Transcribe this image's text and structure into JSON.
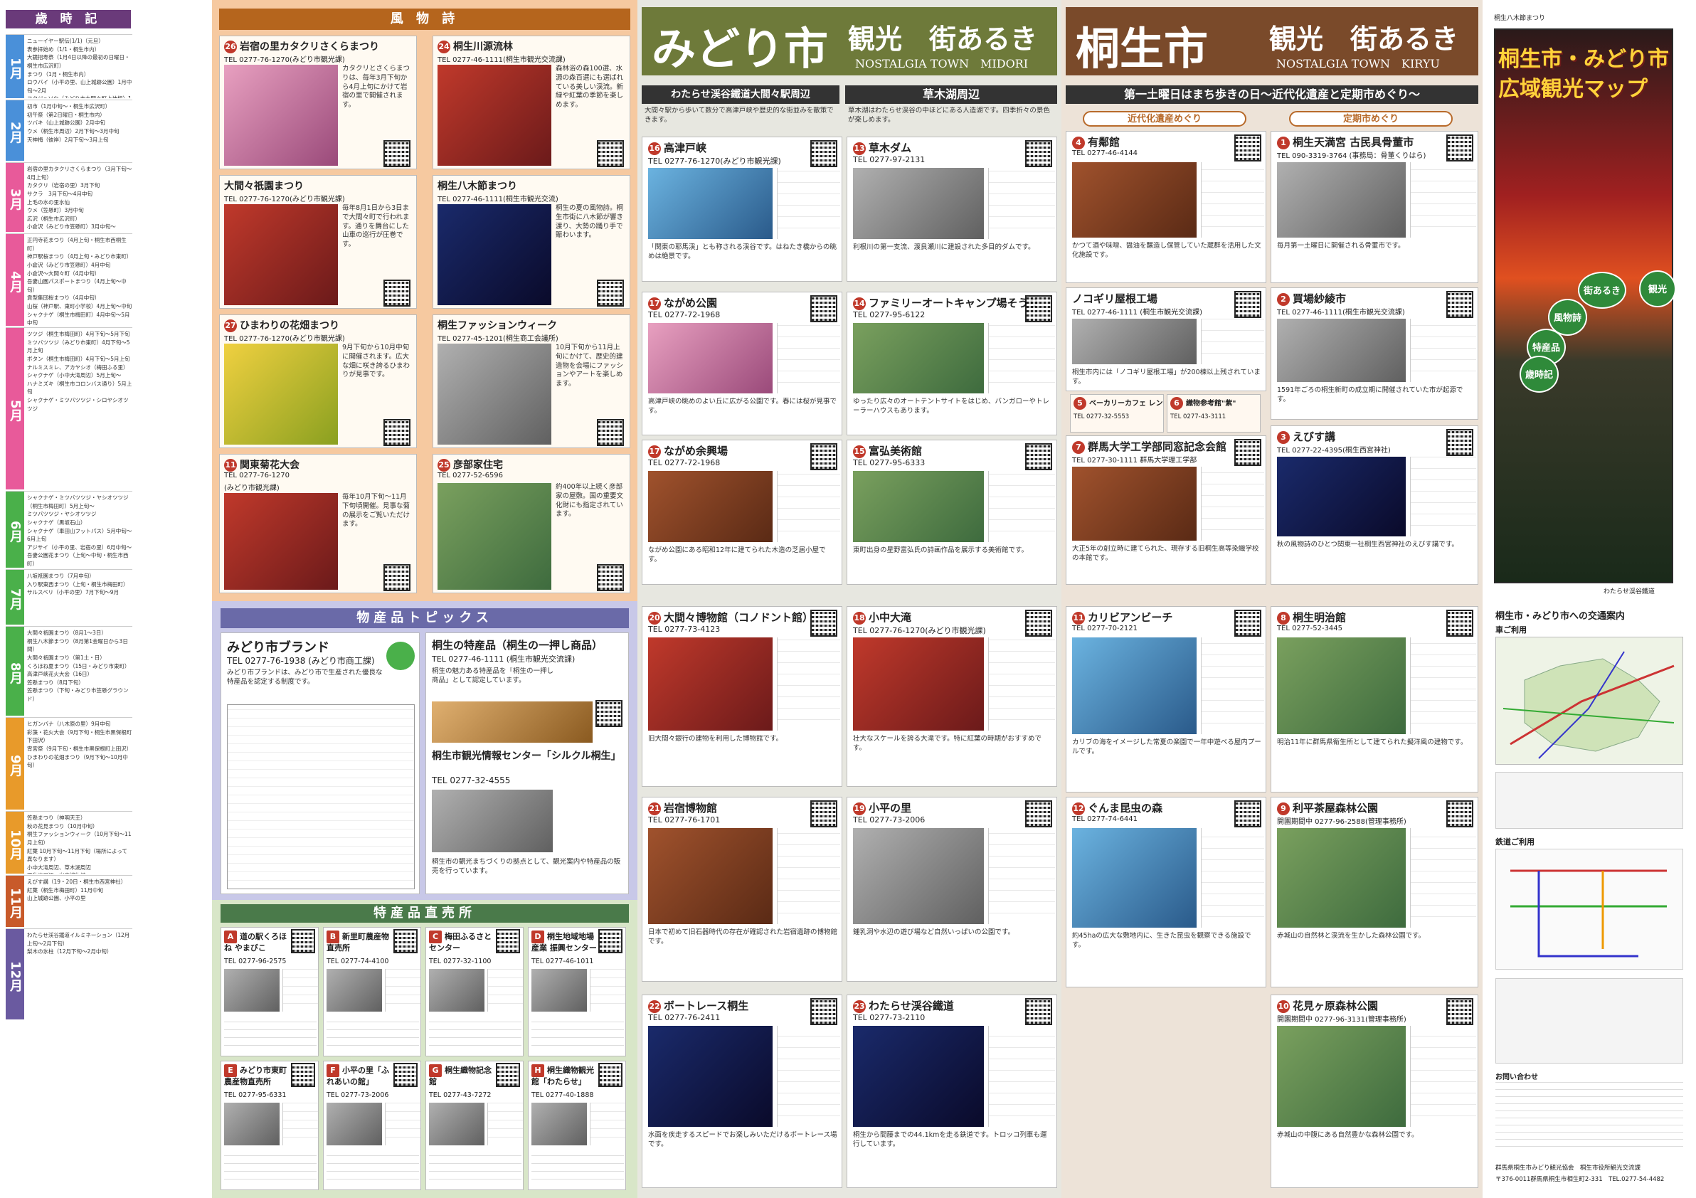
{
  "calendar": {
    "title": "歳 時 記",
    "months": [
      {
        "label": "1月",
        "color": "#4a90d9",
        "text": "ニューイヤー駅伝(1/1)（元旦）\n表参拝始め（1/1・桐生市内）\n大鏡招寿祭（1月4日以降の最初の日曜日・桐生市広沢町）\nまつり（1月・桐生市内）\nロウバイ（小平の里、山上城跡公園）1月中旬～2月\nフクジュソウ（みどり市大間々町上神梅）1月下旬～3月上旬"
      },
      {
        "label": "2月",
        "color": "#4a90d9",
        "text": "初市（1月中旬～・桐生市広沢町）\n初午祭（第2日曜日・桐生市内）\nツバキ（山上城跡公園）2月中旬\nウメ（桐生市周辺）2月下旬～3月中旬\n天神梅（彼岸）2月下旬～3月上旬"
      },
      {
        "label": "3月",
        "color": "#e85a9a",
        "text": "岩宿の里カタクリさくらまつり（3月下旬～4月上旬）\nカタクリ（岩宿の里）3月下旬\nサクラ　3月下旬～4月中旬\n上毛の水の里水仙\nウメ（笠懸町）3月中旬\n広沢（桐生市広沢町）\n小倉沢（みどり市笠懸町）3月中旬～\n小島沢～大間々町"
      },
      {
        "label": "4月",
        "color": "#e85a9a",
        "text": "正円寺花まつり（4月上旬・桐生市西桐生町）\n神戸駅桜まつり（4月上旬・みどり市東町）\n小倉沢（みどり市笠懸町）4月中旬\n小倉沢～大間々町（4月中旬）\n吾妻山園パスポートまつり（4月上旬～中旬）\n貢型集団桜まつり（4月中旬）\n山桜（神戸駅、東町小学校）4月上旬～中旬\nシャクナゲ（桐生市梅田町）4月中旬～5月中旬\nシャクナゲ・ヤシオツツジ（小中大滝周辺）\n桐生の花（車田山フットパス）4月下旬～5月上旬"
      },
      {
        "label": "5月",
        "color": "#e85a9a",
        "text": "ツツジ（桐生市梅田町）4月下旬～5月下旬\nミツバツツジ（みどり市東町）4月下旬～5月上旬\nボタン（桐生市梅田町）4月下旬～5月上旬\nナルミスミレ、アカヤシオ（梅田ふる里）\nシャクナゲ（小中大滝周辺）5月上旬～\nハナミズキ（桐生市コロンバス通り）5月上旬\nシャクナゲ・ミツバツツジ・シロヤシオツツジ"
      },
      {
        "label": "6月",
        "color": "#4ab04a",
        "text": "シャクナゲ・ミツバツツジ・ヤシオツツジ（桐生市梅田町）5月上旬～\nミツバツツジ・ヤシオツツジ\nシャクナゲ（黒坂石山）\nシャクナゲ（車田山フットパス）5月中旬～6月上旬\nアジサイ（小平の里、岩宿の里）6月中旬～\n吾妻公園花まつり（上旬～中旬・桐生市西町）"
      },
      {
        "label": "7月",
        "color": "#4ab04a",
        "text": "八坂祇園まつり（7月中旬）\n入り駅東西まつり（上旬・桐生市梅田町）\nサルスベリ（小平の里）7月下旬～9月"
      },
      {
        "label": "8月",
        "color": "#4ab04a",
        "text": "大間々祇園まつり（8月1～3日）\n桐生八木節まつり（8月第1金曜日から3日間）\n大間々祇園まつり（第1土・日）\nくろほね夏まつり（15日・みどり市東町）\n高津戸峡花火大会（16日）\n笠懸まつり（8月下旬）\n笠懸まつり（下旬・みどり市笠懸グラウンド）"
      },
      {
        "label": "9月",
        "color": "#e89a2a",
        "text": "ヒガンバナ（八木原の里）9月中旬\n彩藻・花火大会（9月下旬・桐生市黒保根町下田沢）\n宵宮祭（9月下旬・桐生市黒保根町上田沢）\nひまわりの花畑まつり（9月下旬～10月中旬）"
      },
      {
        "label": "10月",
        "color": "#e89a2a",
        "text": "笠懸まつり（神明天王）\n秋の花見まつり（10月中旬）\n桐生ファッションウィーク（10月下旬～11月上旬）\n紅葉 10月下旬～11月下旬（場所によって異なります）\n小中大滝周辺、草木湖周辺\n不動滝周辺、岩宿博物館"
      },
      {
        "label": "11月",
        "color": "#c85a2a",
        "text": "えびす講（19・20日・桐生市西宮神社）\n紅葉（桐生市梅田町）11月中旬\n山上城跡公園、小平の里"
      },
      {
        "label": "12月",
        "color": "#6a5aa0",
        "text": "わたらせ渓谷鐵道イルミネーション（12月上旬～2月下旬）\n梨木の氷柱（12月下旬～2月中旬）"
      }
    ]
  },
  "fuubutsu": {
    "head": "風 物 詩",
    "items": [
      {
        "no": "26",
        "title": "岩宿の里カタクリさくらまつり",
        "tel": "TEL 0277-76-1270(みどり市観光課)",
        "desc": "カタクリとさくらまつりは、毎年3月下旬から4月上旬にかけて岩宿の里で開催されます。"
      },
      {
        "no": "24",
        "title": "桐生川源流林",
        "tel": "TEL 0277-46-1111(桐生市観光交流課)",
        "desc": "森林浴の森100選、水源の森百選にも選ばれている美しい渓流。新緑や紅葉の季節を楽しめます。"
      },
      {
        "no": "",
        "title": "大間々祇園まつり",
        "tel": "TEL 0277-76-1270(みどり市観光課)",
        "desc": "毎年8月1日から3日まで大間々町で行われます。通りを舞台にした山車の巡行が圧巻です。"
      },
      {
        "no": "",
        "title": "桐生八木節まつり",
        "tel": "TEL 0277-46-1111(桐生市観光交流)",
        "desc": "桐生の夏の風物詩。桐生市街に八木節が響き渡り、大勢の踊り手で賑わいます。"
      },
      {
        "no": "27",
        "title": "ひまわりの花畑まつり",
        "tel": "TEL 0277-76-1270(みどり市観光課)",
        "desc": "9月下旬から10月中旬に開催されます。広大な畑に咲き誇るひまわりが見事です。"
      },
      {
        "no": "",
        "title": "桐生ファッションウィーク",
        "tel": "TEL 0277-45-1201(桐生商工会議所)",
        "desc": "10月下旬から11月上旬にかけて、歴史的建造物を会場にファッションやアートを楽しめます。"
      },
      {
        "no": "11",
        "title": "関東菊花大会",
        "tel": "TEL 0277-76-1270",
        "tel2": "(みどり市観光課)",
        "desc": "毎年10月下旬～11月下旬頃開催。見事な菊の展示をご覧いただけます。"
      },
      {
        "no": "25",
        "title": "彦部家住宅",
        "tel": "TEL 0277-52-6596",
        "desc": "約400年以上続く彦部家の屋敷。国の重要文化財にも指定されています。"
      }
    ]
  },
  "bussan": {
    "head": "物産品トピックス",
    "brand_title": "みどり市ブランド",
    "brand_tel": "TEL 0277-76-1938 (みどり市商工課)",
    "brand_desc": "みどり市ブランドは、みどり市で生産された優良な特産品を認定する制度です。",
    "kiryu_title": "桐生の特産品（桐生の一押し商品）",
    "kiryu_tel": "TEL 0277-46-1111 (桐生市観光交流課)",
    "kiryu_desc": "桐生の魅力ある特産品を「桐生の一押し商品」として認定しています。",
    "center_title": "桐生市観光情報センター「シルクル桐生」",
    "center_tel": "TEL 0277-32-4555",
    "center_desc": "桐生市の観光まちづくりの拠点として、観光案内や特産品の販売を行っています。"
  },
  "chokubai": {
    "head": "特産品直売所",
    "items": [
      {
        "no": "A",
        "title": "道の駅くろほね やまびこ",
        "tel": "TEL 0277-96-2575"
      },
      {
        "no": "B",
        "title": "新里町農産物 直売所",
        "tel": "TEL 0277-74-4100"
      },
      {
        "no": "C",
        "title": "梅田ふるさと センター",
        "tel": "TEL 0277-32-1100"
      },
      {
        "no": "D",
        "title": "桐生地域地場産業 振興センター",
        "tel": "TEL 0277-46-1011"
      },
      {
        "no": "E",
        "title": "みどり市東町 農産物直売所",
        "tel": "TEL 0277-95-6331"
      },
      {
        "no": "F",
        "title": "小平の里「ふれあいの館」",
        "tel": "TEL 0277-73-2006"
      },
      {
        "no": "G",
        "title": "桐生織物記念館",
        "tel": "TEL 0277-43-7272"
      },
      {
        "no": "H",
        "title": "桐生織物観光館「わたらせ」",
        "tel": "TEL 0277-40-1888"
      }
    ]
  },
  "midori": {
    "name": "みどり市",
    "catch": "観光　街あるき",
    "sub": "NOSTALGIA TOWN　MIDORI",
    "sec1": "わたらせ渓谷鐵道大間々駅周辺",
    "sec1_desc": "大間々駅から歩いて数分で高津戸峡や歴史的な街並みを散策できます。",
    "sec2": "草木湖周辺",
    "sec2_desc": "草木湖はわたらせ渓谷の中ほどにある人造湖です。四季折々の景色が楽しめます。",
    "spots": [
      {
        "no": "16",
        "title": "高津戸峡",
        "tel": "TEL 0277-76-1270(みどり市観光課)",
        "desc": "「関東の耶馬渓」とも称される渓谷です。はねたき橋からの眺めは絶景です。"
      },
      {
        "no": "13",
        "title": "草木ダム",
        "tel": "TEL 0277-97-2131",
        "desc": "利根川の第一支流、渡良瀬川に建設された多目的ダムです。"
      },
      {
        "no": "17",
        "title": "ながめ公園",
        "tel": "TEL 0277-72-1968",
        "desc": "高津戸峡の眺めのよい丘に広がる公園です。春には桜が見事です。"
      },
      {
        "no": "14",
        "title": "ファミリーオートキャンプ場そうり",
        "tel": "TEL 0277-95-6122",
        "desc": "ゆったり広々のオートテントサイトをはじめ、バンガローやトレーラーハウスもあります。"
      },
      {
        "no": "17",
        "title": "ながめ余興場",
        "tel": "TEL 0277-72-1968",
        "desc": "ながめ公園にある昭和12年に建てられた木造の芝居小屋です。"
      },
      {
        "no": "15",
        "title": "富弘美術館",
        "tel": "TEL 0277-95-6333",
        "desc": "東町出身の星野富弘氏の詩画作品を展示する美術館です。"
      },
      {
        "no": "20",
        "title": "大間々博物館（コノドント館）",
        "tel": "TEL 0277-73-4123",
        "desc": "旧大間々銀行の建物を利用した博物館です。"
      },
      {
        "no": "18",
        "title": "小中大滝",
        "tel": "TEL 0277-76-1270(みどり市観光課)",
        "desc": "壮大なスケールを誇る大滝です。特に紅葉の時期がおすすめです。"
      },
      {
        "no": "21",
        "title": "岩宿博物館",
        "tel": "TEL 0277-76-1701",
        "desc": "日本で初めて旧石器時代の存在が確認された岩宿遺跡の博物館です。"
      },
      {
        "no": "19",
        "title": "小平の里",
        "tel": "TEL 0277-73-2006",
        "desc": "鍾乳洞や水辺の遊び場など自然いっぱいの公園です。"
      },
      {
        "no": "22",
        "title": "ボートレース桐生",
        "tel": "TEL 0277-76-2411",
        "desc": "水面を疾走するスピードでお楽しみいただけるボートレース場です。"
      },
      {
        "no": "23",
        "title": "わたらせ渓谷鐵道",
        "tel": "TEL 0277-73-2110",
        "desc": "桐生から間藤までの44.1kmを走る鉄道です。トロッコ列車も運行しています。"
      }
    ]
  },
  "kiryu": {
    "name": "桐生市",
    "catch": "観光　街あるき",
    "sub": "NOSTALGIA TOWN　KIRYU",
    "band": "第一土曜日はまち歩きの日～近代化遺産と定期市めぐり～",
    "sub1": "近代化遺産めぐり",
    "sub2": "定期市めぐり",
    "spots": [
      {
        "no": "4",
        "title": "有鄰館",
        "tel": "TEL 0277-46-4144",
        "desc": "かつて酒や味噌、醤油を醸造し保管していた蔵群を活用した文化施設です。"
      },
      {
        "no": "1",
        "title": "桐生天満宮 古民具骨董市",
        "tel": "TEL 090-3319-3764 (事務局：骨董くりはら)",
        "desc": "毎月第一土曜日に開催される骨董市です。"
      },
      {
        "no": "",
        "title": "ノコギリ屋根工場",
        "tel": "TEL 0277-46-1111 (桐生市観光交流課)",
        "desc": "桐生市内には「ノコギリ屋根工場」が200棟以上残されています。"
      },
      {
        "no": "2",
        "title": "買場紗綾市",
        "tel": "TEL 0277-46-1111(桐生市観光交流課)",
        "desc": "1591年ごろの桐生新町の成立期に開催されていた市が起源です。"
      },
      {
        "no": "5",
        "title": "ベーカリーカフェ レンガ",
        "tel": "TEL 0277-32-5553"
      },
      {
        "no": "6",
        "title": "織物参考館\"紫\"",
        "tel": "TEL 0277-43-3111"
      },
      {
        "no": "3",
        "title": "えびす講",
        "tel": "TEL 0277-22-4395(桐生西宮神社)",
        "desc": "秋の風物詩のひとつ関東一社桐生西宮神社のえびす講です。"
      },
      {
        "no": "7",
        "title": "群馬大学工学部同窓記念会館",
        "tel": "TEL 0277-30-1111 群馬大学理工学部",
        "desc": "大正5年の創立時に建てられた、現存する旧桐生高等染織学校の本館です。"
      },
      {
        "no": "11",
        "title": "カリビアンビーチ",
        "tel": "TEL 0277-70-2121",
        "desc": "カリブの海をイメージした常夏の楽園で一年中遊べる屋内プールです。"
      },
      {
        "no": "8",
        "title": "桐生明治館",
        "tel": "TEL 0277-52-3445",
        "desc": "明治11年に群馬県衛生所として建てられた擬洋風の建物です。"
      },
      {
        "no": "12",
        "title": "ぐんま昆虫の森",
        "tel": "TEL 0277-74-6441",
        "desc": "約45haの広大な敷地内に、生きた昆虫を観察できる施設です。"
      },
      {
        "no": "9",
        "title": "利平茶屋森林公園",
        "tel": "開園期間中 0277-96-2588(管理事務所)",
        "desc": "赤城山の自然林と渓流を生かした森林公園です。"
      },
      {
        "no": "10",
        "title": "花見ヶ原森林公園",
        "tel": "開園期間中 0277-96-3131(管理事務所)",
        "desc": "赤城山の中腹にある自然豊かな森林公園です。"
      }
    ]
  },
  "cover": {
    "small": "桐生八木節まつり",
    "title1": "桐生市・みどり市",
    "title2": "広域観光マップ",
    "tags": [
      "観光",
      "街あるき",
      "風物詩",
      "特産品",
      "歳時記"
    ],
    "caption": "わたらせ渓谷鐵道"
  },
  "access": {
    "title": "桐生市・みどり市への交通案内",
    "car": "車ご利用",
    "rail": "鉄道ご利用",
    "contacts": "お問い合わせ",
    "footer1": "群馬県桐生市みどり観光協会　桐生市役所観光交流課",
    "footer2": "〒376-0011群馬県桐生市相生町2-331　TEL.0277-54-4482"
  }
}
